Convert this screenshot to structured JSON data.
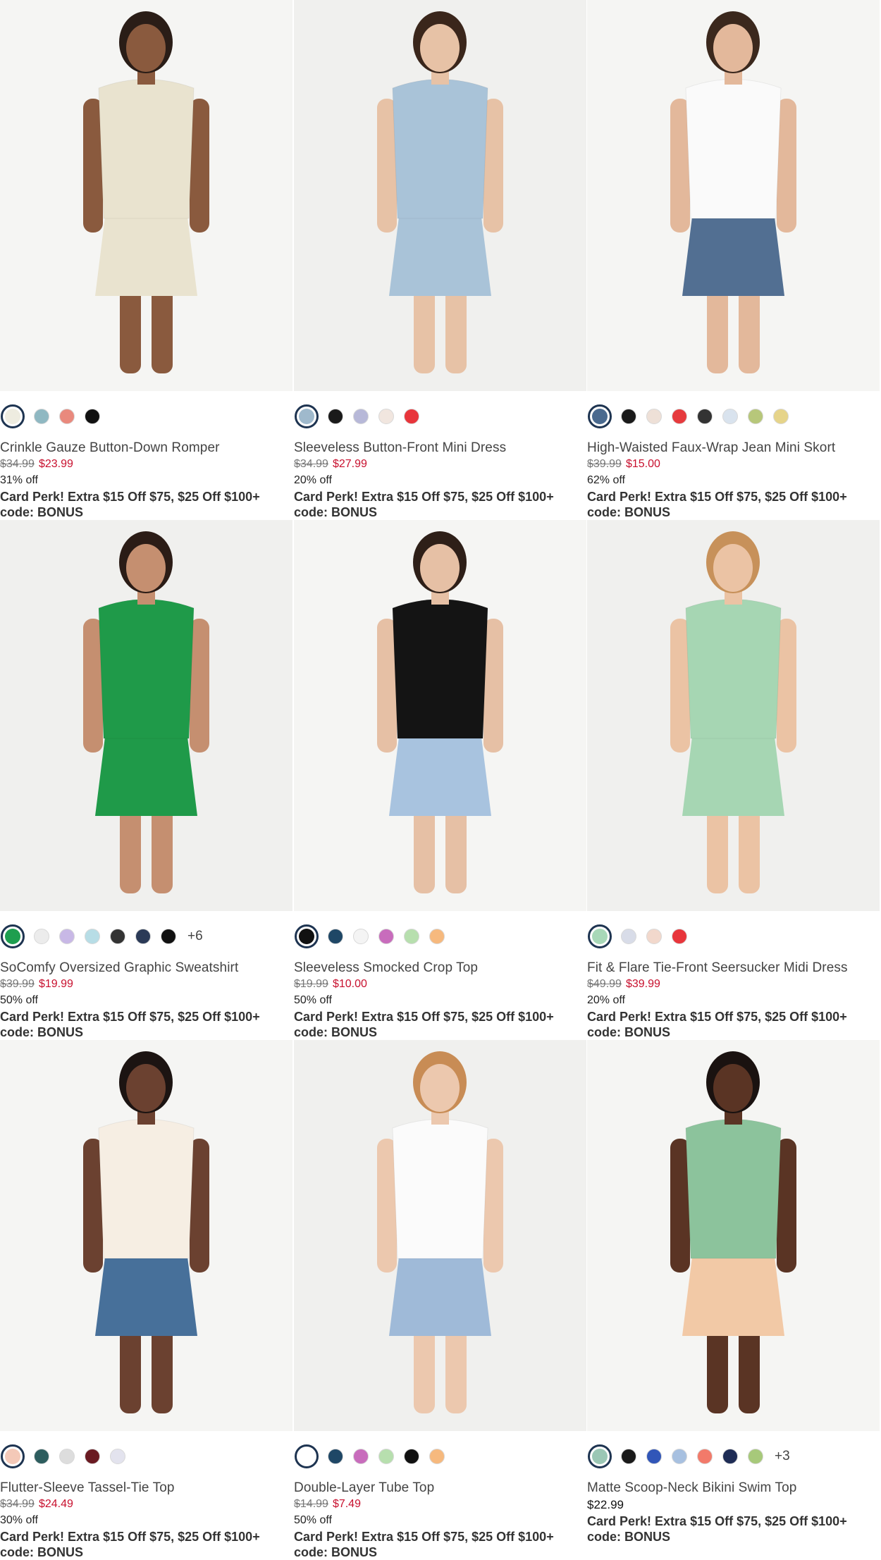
{
  "products": [
    {
      "name": "Crinkle Gauze Button-Down Romper",
      "was": "$34.99",
      "now": "$23.99",
      "off": "31% off",
      "perk": "Card Perk! Extra $15 Off $75, $25 Off $100+",
      "code": "code: BONUS",
      "swatches": [
        "#eeece0",
        "#8fb8c2",
        "#e9897d",
        "#111111"
      ],
      "more": "",
      "garment": "#e9e3cf",
      "bottom": "#e9e3cf",
      "skin": "#8a5a3e",
      "hair": "#2a1d17"
    },
    {
      "name": "Sleeveless Button-Front Mini Dress",
      "was": "$34.99",
      "now": "$27.99",
      "off": "20% off",
      "perk": "Card Perk! Extra $15 Off $75, $25 Off $100+",
      "code": "code: BONUS",
      "swatches": [
        "#9fb9cc",
        "#1a1a1a",
        "#b7b8d8",
        "#f1e6df",
        "#e8353b"
      ],
      "more": "",
      "garment": "#a9c3d8",
      "bottom": "#a9c3d8",
      "skin": "#e7c2a6",
      "hair": "#3a261b"
    },
    {
      "name": "High-Waisted Faux-Wrap Jean Mini Skort",
      "was": "$39.99",
      "now": "$15.00",
      "off": "62% off",
      "perk": "Card Perk! Extra $15 Off $75, $25 Off $100+",
      "code": "code: BONUS",
      "swatches": [
        "#4a6a8f",
        "#1a1a1a",
        "#eee0d7",
        "#e63a3d",
        "#333333",
        "#d9e3ee",
        "#b7c77a",
        "#e6d48a"
      ],
      "more": "",
      "garment": "#fafafa",
      "bottom": "#526f92",
      "skin": "#e3b89b",
      "hair": "#3b281d"
    },
    {
      "name": "SoComfy Oversized Graphic Sweatshirt",
      "was": "$39.99",
      "now": "$19.99",
      "off": "50% off",
      "perk": "Card Perk! Extra $15 Off $75, $25 Off $100+",
      "code": "code: BONUS",
      "swatches": [
        "#1e9e4f",
        "#ececec",
        "#c8b8e6",
        "#b7dde6",
        "#333333",
        "#2b3a57",
        "#111111"
      ],
      "more": "+6",
      "garment": "#1f9a49",
      "bottom": "#1f9a49",
      "skin": "#c58f70",
      "hair": "#2b1c16"
    },
    {
      "name": "Sleeveless Smocked Crop Top",
      "was": "$19.99",
      "now": "$10.00",
      "off": "50% off",
      "perk": "Card Perk! Extra $15 Off $75, $25 Off $100+",
      "code": "code: BONUS",
      "swatches": [
        "#111111",
        "#1f4766",
        "#f4f4f4",
        "#c86cbc",
        "#b7dfae",
        "#f6b97e"
      ],
      "more": "",
      "garment": "#141414",
      "bottom": "#a8c3df",
      "skin": "#e6c0a5",
      "hair": "#2e1f18"
    },
    {
      "name": "Fit & Flare Tie-Front Seersucker Midi Dress",
      "was": "$49.99",
      "now": "$39.99",
      "off": "20% off",
      "perk": "Card Perk! Extra $15 Off $75, $25 Off $100+",
      "code": "code: BONUS",
      "swatches": [
        "#a8d8b8",
        "#d8dce8",
        "#f2d8cc",
        "#e8353b"
      ],
      "more": "",
      "garment": "#a6d6b3",
      "bottom": "#a6d6b3",
      "skin": "#ebc3a4",
      "hair": "#c7915a"
    },
    {
      "name": "Flutter-Sleeve Tassel-Tie Top",
      "was": "$34.99",
      "now": "$24.49",
      "off": "30% off",
      "perk": "Card Perk! Extra $15 Off $75, $25 Off $100+",
      "code": "code: BONUS",
      "swatches": [
        "#f4c9b8",
        "#2d5d5e",
        "#dddddd",
        "#6a1a22",
        "#e3e3ee"
      ],
      "more": "",
      "garment": "#f6eee3",
      "bottom": "#47709a",
      "skin": "#6b4130",
      "hair": "#1c1412"
    },
    {
      "name": "Double-Layer Tube Top",
      "was": "$14.99",
      "now": "$7.49",
      "off": "50% off",
      "perk": "Card Perk! Extra $15 Off $75, $25 Off $100+",
      "code": "code: BONUS",
      "swatches": [
        "#ffffff",
        "#1f4766",
        "#c86cbc",
        "#b7dfae",
        "#111111",
        "#f6b97e"
      ],
      "more": "",
      "garment": "#fbfbfb",
      "bottom": "#9fbad8",
      "skin": "#ecc8ae",
      "hair": "#c88c55"
    },
    {
      "name": "Matte Scoop-Neck Bikini Swim Top",
      "was": "",
      "now": "",
      "regular": "$22.99",
      "off": "",
      "perk": "Card Perk! Extra $15 Off $75, $25 Off $100+",
      "code": "code: BONUS",
      "swatches": [
        "#9bc7b5",
        "#1a1a1a",
        "#3156b8",
        "#a7c0e0",
        "#f27a6a",
        "#1e2c55",
        "#a7c97a"
      ],
      "more": "+3",
      "garment": "#8cc39c",
      "bottom": "#f2c9a6",
      "skin": "#5a3424",
      "hair": "#1a1210"
    }
  ]
}
